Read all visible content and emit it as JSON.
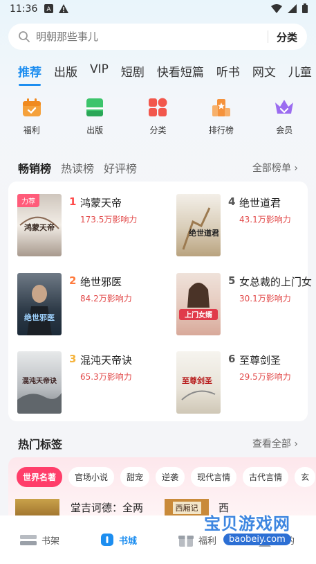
{
  "status": {
    "time": "11:36"
  },
  "search": {
    "placeholder": "明朝那些事儿",
    "category_label": "分类"
  },
  "tabs": [
    "推荐",
    "出版",
    "VIP",
    "短剧",
    "快看短篇",
    "听书",
    "网文",
    "儿童"
  ],
  "quick_entries": [
    {
      "label": "福利",
      "icon": "gift-calendar-icon",
      "color": "#f5a13b"
    },
    {
      "label": "出版",
      "icon": "book-icon",
      "color": "#3cc46b"
    },
    {
      "label": "分类",
      "icon": "grid-icon",
      "color": "#f2574c"
    },
    {
      "label": "排行榜",
      "icon": "ranking-icon",
      "color": "#f5923b"
    },
    {
      "label": "会员",
      "icon": "crown-icon",
      "color": "#9b6cf0"
    }
  ],
  "rank_tabs": [
    "畅销榜",
    "热读榜",
    "好评榜"
  ],
  "all_rank_label": "全部榜单",
  "books": [
    {
      "rank": "1",
      "title": "鸿蒙天帝",
      "influence": "173.5万影响力",
      "badge": "力荐",
      "cover_text": "鸿蒙天帝"
    },
    {
      "rank": "2",
      "title": "绝世邪医",
      "influence": "84.2万影响力",
      "badge": "",
      "cover_text": "绝世邪医"
    },
    {
      "rank": "3",
      "title": "混沌天帝诀",
      "influence": "65.3万影响力",
      "badge": "",
      "cover_text": "混沌天帝诀"
    },
    {
      "rank": "4",
      "title": "绝世道君",
      "influence": "43.1万影响力",
      "badge": "",
      "cover_text": "绝世道君"
    },
    {
      "rank": "5",
      "title": "女总裁的上门女",
      "influence": "30.1万影响力",
      "badge": "",
      "cover_text": "上门女婿"
    },
    {
      "rank": "6",
      "title": "至尊剑圣",
      "influence": "29.5万影响力",
      "badge": "",
      "cover_text": "至尊剑圣"
    }
  ],
  "rank_colors": {
    "1": "#ff4a4a",
    "2": "#ff7a3d",
    "3": "#f5b33b",
    "other": "#555555"
  },
  "hot_tags": {
    "title": "热门标签",
    "see_all": "查看全部",
    "tags": [
      "世界名著",
      "官场小说",
      "甜宠",
      "逆袭",
      "现代言情",
      "古代言情",
      "玄"
    ]
  },
  "tag_books": [
    {
      "title": "堂吉诃德：全两"
    },
    {
      "title": "西厢记",
      "cover_text": "西厢记"
    },
    {
      "title": "西"
    }
  ],
  "bottom_nav": [
    {
      "label": "书架",
      "icon": "bookshelf-icon"
    },
    {
      "label": "书城",
      "icon": "bookstore-icon"
    },
    {
      "label": "福利",
      "icon": "gift-icon"
    },
    {
      "label": "我的",
      "icon": "profile-icon"
    }
  ],
  "watermark": {
    "text": "宝贝游戏网",
    "url": "baobeiy.com"
  }
}
